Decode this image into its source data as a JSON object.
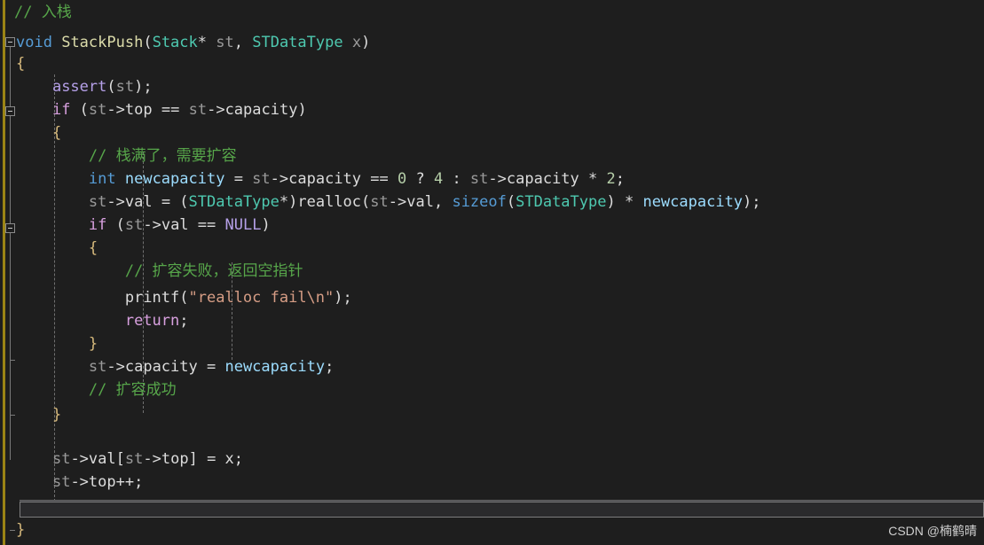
{
  "editor": {
    "language": "c",
    "background_color": "#1e1e1e",
    "default_text_color": "#dcdcdc",
    "change_bar_color": "#9b8415",
    "comment_color": "#57a64a",
    "keyword_color": "#569cd6",
    "control_keyword_color": "#d8a0df",
    "function_color": "#dcdcaa",
    "type_color": "#4ec9b0",
    "macro_color": "#b5a0e8",
    "local_var_color": "#9cdcfe",
    "string_color": "#d69d85",
    "number_color": "#b5cea8",
    "brace_color": "#d7ba7d"
  },
  "code": {
    "lines": [
      {
        "n": 1,
        "text": "// 入栈"
      },
      {
        "n": 2,
        "text": "void StackPush(Stack* st, STDataType x)"
      },
      {
        "n": 3,
        "text": "{"
      },
      {
        "n": 4,
        "text": "    assert(st);"
      },
      {
        "n": 5,
        "text": "    if (st->top == st->capacity)"
      },
      {
        "n": 6,
        "text": "    {"
      },
      {
        "n": 7,
        "text": "        // 栈满了，需要扩容"
      },
      {
        "n": 8,
        "text": "        int newcapacity = st->capacity == 0 ? 4 : st->capacity * 2;"
      },
      {
        "n": 9,
        "text": "        st->val = (STDataType*)realloc(st->val, sizeof(STDataType) * newcapacity);"
      },
      {
        "n": 10,
        "text": "        if (st->val == NULL)"
      },
      {
        "n": 11,
        "text": "        {"
      },
      {
        "n": 12,
        "text": "            // 扩容失败，返回空指针"
      },
      {
        "n": 13,
        "text": "            printf(\"realloc fail\\n\");"
      },
      {
        "n": 14,
        "text": "            return;"
      },
      {
        "n": 15,
        "text": "        }"
      },
      {
        "n": 16,
        "text": "        st->capacity = newcapacity;"
      },
      {
        "n": 17,
        "text": "        // 扩容成功"
      },
      {
        "n": 18,
        "text": "    }"
      },
      {
        "n": 19,
        "text": ""
      },
      {
        "n": 20,
        "text": "    st->val[st->top] = x;"
      },
      {
        "n": 21,
        "text": "    st->top++;"
      },
      {
        "n": 22,
        "text": "}"
      }
    ],
    "tokens": {
      "line1": {
        "comment": "// 入栈"
      },
      "line2": {
        "kw": "void",
        "fn": "StackPush",
        "type1": "Stack",
        "star": "*",
        "param1": "st",
        "type2": "STDataType",
        "param2": "x"
      },
      "line4": {
        "macro": "assert",
        "obj": "st"
      },
      "line5": {
        "ctl": "if",
        "obj": "st",
        "mem1": "top",
        "op": "==",
        "mem2": "capacity"
      },
      "line7": {
        "comment": "// 栈满了，需要扩容"
      },
      "line8": {
        "kw": "int",
        "var": "newcapacity",
        "obj": "st",
        "mem": "capacity",
        "num1": "0",
        "num2": "4",
        "num3": "2"
      },
      "line9": {
        "obj": "st",
        "mem": "val",
        "type": "STDataType",
        "fn1": "realloc",
        "fn2": "sizeof",
        "var": "newcapacity"
      },
      "line10": {
        "ctl": "if",
        "obj": "st",
        "mem": "val",
        "macro": "NULL"
      },
      "line12": {
        "comment": "// 扩容失败，返回空指针"
      },
      "line13": {
        "fn": "printf",
        "str": "\"realloc fail\\n\""
      },
      "line14": {
        "ctl": "return"
      },
      "line16": {
        "obj": "st",
        "mem": "capacity",
        "var": "newcapacity"
      },
      "line17": {
        "comment": "// 扩容成功"
      },
      "line20": {
        "obj": "st",
        "mem1": "val",
        "mem2": "top",
        "ident": "x"
      },
      "line21": {
        "obj": "st",
        "mem": "top"
      }
    }
  },
  "gutter": {
    "fold_markers": [
      {
        "name": "fold-marker-function",
        "line": 2
      },
      {
        "name": "fold-marker-if-capacity",
        "line": 5
      },
      {
        "name": "fold-marker-if-null",
        "line": 10
      }
    ],
    "glyph": "minus"
  },
  "scrollbar": {
    "orientation": "horizontal",
    "thumb_label": ""
  },
  "watermark": {
    "text": "CSDN @楠鹤晴"
  }
}
